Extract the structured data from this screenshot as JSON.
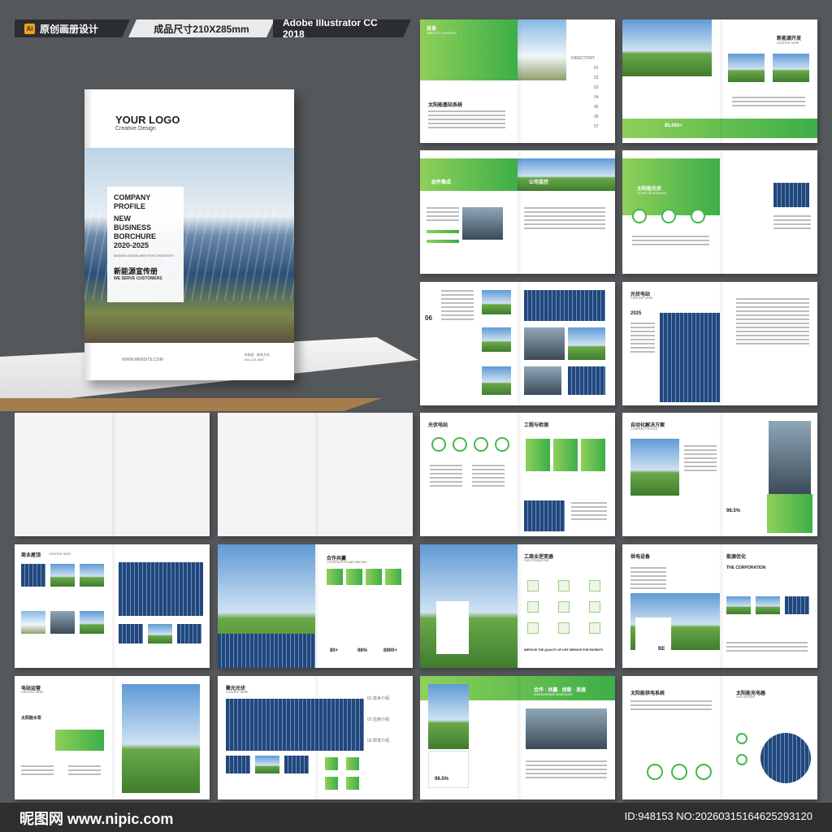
{
  "header": {
    "tag1_label": "原创画册设计",
    "tag1_icon": "Ai",
    "tag2_label": "成品尺寸210X285mm",
    "tag3_label": "Adobe Illustrator CC 2018"
  },
  "cover": {
    "logo": "YOUR LOGO",
    "logo_sub": "Creative Design",
    "title_lines": [
      "COMPANY",
      "PROFILE",
      "NEW",
      "BUSINESS",
      "BORCHURE",
      "2020-2025"
    ],
    "subtitle": "DESIGN GUIDELINES FOR CREATIVITY",
    "cn_title": "新能源宣传册",
    "tagline": "WE SERVE CUSTOMERS",
    "website": "WWW.WEBSITE.COM",
    "contact_lines": [
      "市场部 · 联系方式",
      "400-123-4567"
    ]
  },
  "spreads": {
    "contents": {
      "title": "目录",
      "sub": "TABLE OF CONTENTS",
      "dir_label": "DIRECTORY",
      "left_heading": "太阳能基站系统",
      "numbers": [
        "01",
        "02",
        "03",
        "04",
        "05",
        "06",
        "07"
      ]
    },
    "scope": {
      "heading": "新能源开发",
      "sub": "CONTENT HERE",
      "stat": "85.000+"
    },
    "enterprise": {
      "left": "组件集成",
      "right": "公司监控"
    },
    "business": {
      "heading": "太阳能光伏",
      "sub": "SCOPE OF BUSINESS"
    },
    "profile": {
      "label": "06"
    },
    "pv": {
      "heading": "光伏电站",
      "sub": "CONTENT HERE",
      "year": "2025"
    },
    "pv2": {
      "left": "光伏电站",
      "right": "工程与检测"
    },
    "automation": {
      "heading": "自动化解决方案",
      "sub": "COMPANY PROFILE",
      "stat": "98.5%"
    },
    "commerce": {
      "heading": "商业屋顶",
      "sub": "CONTENT HERE"
    },
    "cooperation": {
      "heading": "合作共赢",
      "sub": "COOPERATION AND WIN-WIN",
      "stats": [
        "80+",
        "98%",
        "8900+"
      ]
    },
    "inverter": {
      "heading": "工商业逆变器",
      "sub": "OUR STRENGTHS",
      "tagline": "IMPROVE THE QUALITY OF LIFE SERVICE FOR PATIENTS"
    },
    "power": {
      "left": "供电设备",
      "right": "能源优化",
      "right_sub": "THE CORPORATION",
      "badge": "BE"
    },
    "station": {
      "heading": "电站运营",
      "sub": "CONTENT HERE",
      "left_sub": "太阳能水泵"
    },
    "cluster": {
      "heading": "聚光光伏",
      "sub": "CONTENT HERE",
      "items": [
        "01 技术介绍",
        "02 应用介绍",
        "03 研发介绍"
      ]
    },
    "cooperate": {
      "heading": "合作 · 共赢 · 创新 · 发展",
      "sub": "NEW BUSINESS BORCHURE",
      "stat": "98.5%"
    },
    "supply": {
      "heading": "太阳能供电系统",
      "right": "太阳能充电器",
      "right_sub": "OUR OFFERS"
    }
  },
  "footer": {
    "watermark": "昵图网 www.nipic.com",
    "id_text": "ID:948153 NO:20260315164625293120"
  },
  "colors": {
    "background": "#55585b",
    "accent_green": "#45b84a",
    "light_green": "#8fd05a",
    "dark": "#2b2d30"
  }
}
